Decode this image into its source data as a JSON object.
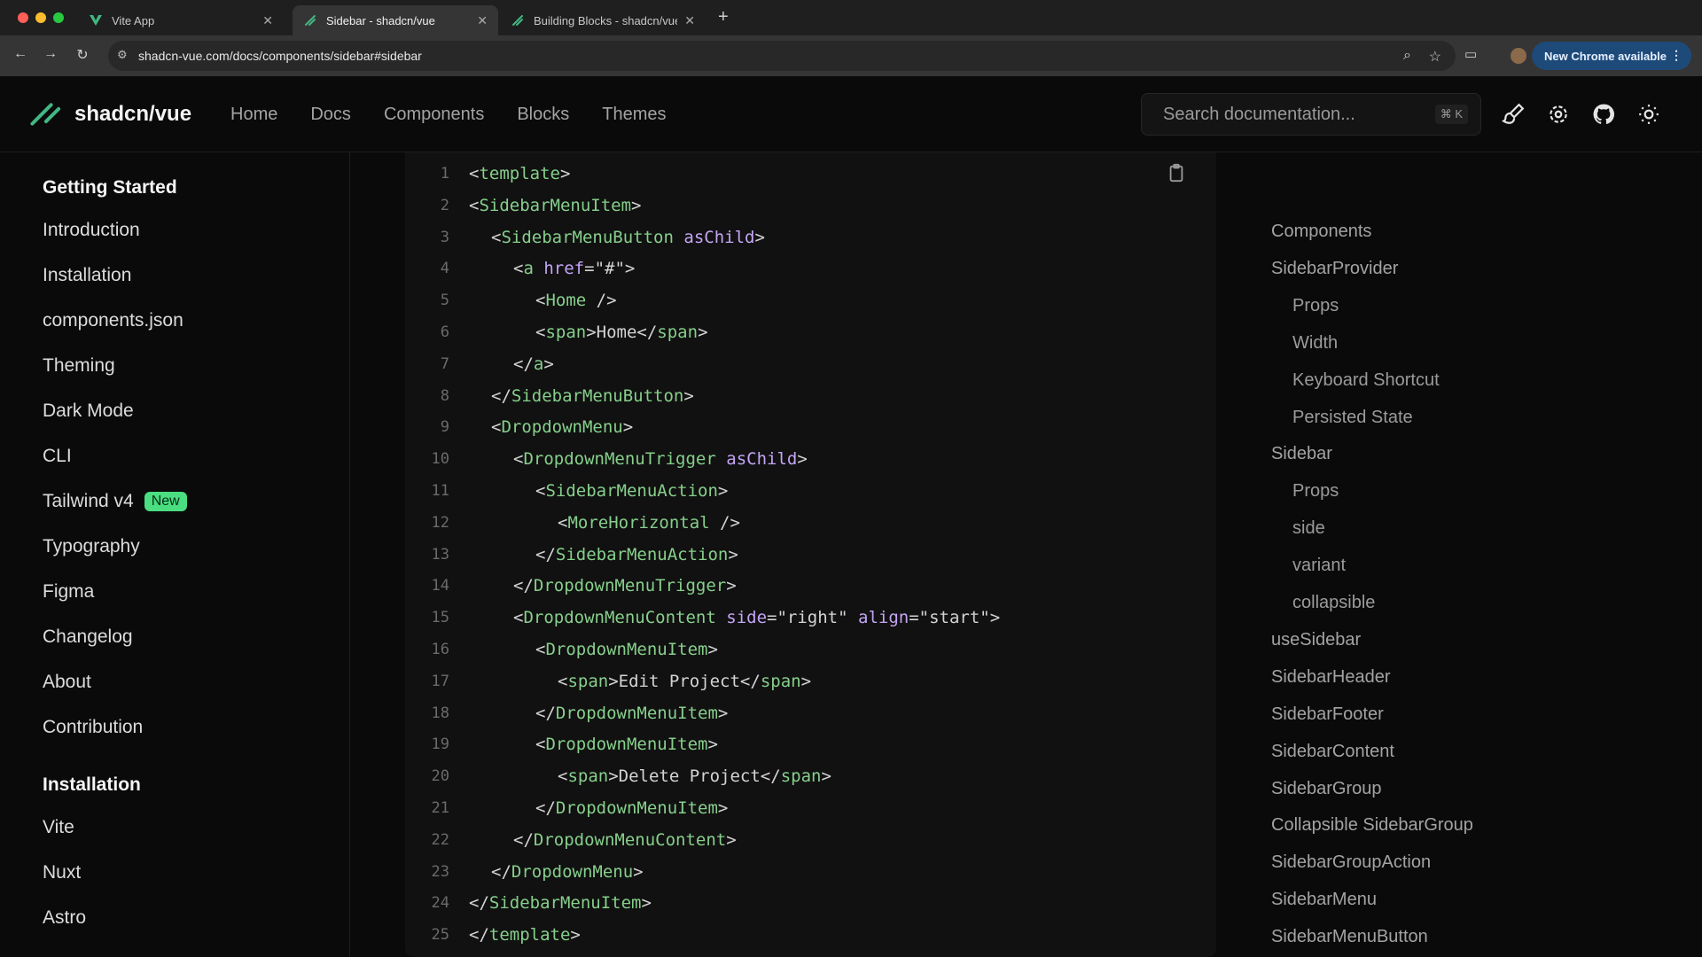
{
  "browser": {
    "tabs": [
      {
        "title": "Vite App",
        "active": false
      },
      {
        "title": "Sidebar - shadcn/vue",
        "active": true
      },
      {
        "title": "Building Blocks - shadcn/vue",
        "active": false
      }
    ],
    "url": "shadcn-vue.com/docs/components/sidebar#sidebar",
    "update_button": "New Chrome available"
  },
  "header": {
    "logo_text": "shadcn/vue",
    "nav": [
      "Home",
      "Docs",
      "Components",
      "Blocks",
      "Themes"
    ],
    "search_placeholder": "Search documentation...",
    "search_shortcut": "⌘ K"
  },
  "sidebar": {
    "sections": [
      {
        "title": "Getting Started",
        "items": [
          {
            "label": "Introduction"
          },
          {
            "label": "Installation"
          },
          {
            "label": "components.json"
          },
          {
            "label": "Theming"
          },
          {
            "label": "Dark Mode"
          },
          {
            "label": "CLI"
          },
          {
            "label": "Tailwind v4",
            "badge": "New"
          },
          {
            "label": "Typography"
          },
          {
            "label": "Figma"
          },
          {
            "label": "Changelog"
          },
          {
            "label": "About"
          },
          {
            "label": "Contribution"
          }
        ]
      },
      {
        "title": "Installation",
        "items": [
          {
            "label": "Vite"
          },
          {
            "label": "Nuxt"
          },
          {
            "label": "Astro"
          }
        ]
      }
    ]
  },
  "code": {
    "lines": [
      {
        "n": "1",
        "indent": 0,
        "tokens": [
          [
            "p",
            "<"
          ],
          [
            "tag",
            "template"
          ],
          [
            "p",
            ">"
          ]
        ]
      },
      {
        "n": "2",
        "indent": 0,
        "tokens": [
          [
            "p",
            "<"
          ],
          [
            "tag",
            "SidebarMenuItem"
          ],
          [
            "p",
            ">"
          ]
        ]
      },
      {
        "n": "3",
        "indent": 1,
        "tokens": [
          [
            "p",
            "<"
          ],
          [
            "tag",
            "SidebarMenuButton"
          ],
          [
            "p",
            " "
          ],
          [
            "attr",
            "asChild"
          ],
          [
            "p",
            ">"
          ]
        ]
      },
      {
        "n": "4",
        "indent": 2,
        "tokens": [
          [
            "p",
            "<"
          ],
          [
            "tag",
            "a"
          ],
          [
            "p",
            " "
          ],
          [
            "attr",
            "href"
          ],
          [
            "p",
            "="
          ],
          [
            "str",
            "\"#\""
          ],
          [
            "p",
            ">"
          ]
        ]
      },
      {
        "n": "5",
        "indent": 3,
        "tokens": [
          [
            "p",
            "<"
          ],
          [
            "tag",
            "Home"
          ],
          [
            "p",
            " />"
          ]
        ]
      },
      {
        "n": "6",
        "indent": 3,
        "tokens": [
          [
            "p",
            "<"
          ],
          [
            "tag",
            "span"
          ],
          [
            "p",
            ">Home</"
          ],
          [
            "tag",
            "span"
          ],
          [
            "p",
            ">"
          ]
        ]
      },
      {
        "n": "7",
        "indent": 2,
        "tokens": [
          [
            "p",
            "</"
          ],
          [
            "tag",
            "a"
          ],
          [
            "p",
            ">"
          ]
        ]
      },
      {
        "n": "8",
        "indent": 1,
        "tokens": [
          [
            "p",
            "</"
          ],
          [
            "tag",
            "SidebarMenuButton"
          ],
          [
            "p",
            ">"
          ]
        ]
      },
      {
        "n": "9",
        "indent": 1,
        "tokens": [
          [
            "p",
            "<"
          ],
          [
            "tag",
            "DropdownMenu"
          ],
          [
            "p",
            ">"
          ]
        ]
      },
      {
        "n": "10",
        "indent": 2,
        "tokens": [
          [
            "p",
            "<"
          ],
          [
            "tag",
            "DropdownMenuTrigger"
          ],
          [
            "p",
            " "
          ],
          [
            "attr",
            "asChild"
          ],
          [
            "p",
            ">"
          ]
        ]
      },
      {
        "n": "11",
        "indent": 3,
        "tokens": [
          [
            "p",
            "<"
          ],
          [
            "tag",
            "SidebarMenuAction"
          ],
          [
            "p",
            ">"
          ]
        ]
      },
      {
        "n": "12",
        "indent": 4,
        "tokens": [
          [
            "p",
            "<"
          ],
          [
            "tag",
            "MoreHorizontal"
          ],
          [
            "p",
            " />"
          ]
        ]
      },
      {
        "n": "13",
        "indent": 3,
        "tokens": [
          [
            "p",
            "</"
          ],
          [
            "tag",
            "SidebarMenuAction"
          ],
          [
            "p",
            ">"
          ]
        ]
      },
      {
        "n": "14",
        "indent": 2,
        "tokens": [
          [
            "p",
            "</"
          ],
          [
            "tag",
            "DropdownMenuTrigger"
          ],
          [
            "p",
            ">"
          ]
        ]
      },
      {
        "n": "15",
        "indent": 2,
        "tokens": [
          [
            "p",
            "<"
          ],
          [
            "tag",
            "DropdownMenuContent"
          ],
          [
            "p",
            " "
          ],
          [
            "attr",
            "side"
          ],
          [
            "p",
            "="
          ],
          [
            "str",
            "\"right\""
          ],
          [
            "p",
            " "
          ],
          [
            "attr",
            "align"
          ],
          [
            "p",
            "="
          ],
          [
            "str",
            "\"start\""
          ],
          [
            "p",
            ">"
          ]
        ]
      },
      {
        "n": "16",
        "indent": 3,
        "tokens": [
          [
            "p",
            "<"
          ],
          [
            "tag",
            "DropdownMenuItem"
          ],
          [
            "p",
            ">"
          ]
        ]
      },
      {
        "n": "17",
        "indent": 4,
        "tokens": [
          [
            "p",
            "<"
          ],
          [
            "tag",
            "span"
          ],
          [
            "p",
            ">Edit Project</"
          ],
          [
            "tag",
            "span"
          ],
          [
            "p",
            ">"
          ]
        ]
      },
      {
        "n": "18",
        "indent": 3,
        "tokens": [
          [
            "p",
            "</"
          ],
          [
            "tag",
            "DropdownMenuItem"
          ],
          [
            "p",
            ">"
          ]
        ]
      },
      {
        "n": "19",
        "indent": 3,
        "tokens": [
          [
            "p",
            "<"
          ],
          [
            "tag",
            "DropdownMenuItem"
          ],
          [
            "p",
            ">"
          ]
        ]
      },
      {
        "n": "20",
        "indent": 4,
        "tokens": [
          [
            "p",
            "<"
          ],
          [
            "tag",
            "span"
          ],
          [
            "p",
            ">Delete Project</"
          ],
          [
            "tag",
            "span"
          ],
          [
            "p",
            ">"
          ]
        ]
      },
      {
        "n": "21",
        "indent": 3,
        "tokens": [
          [
            "p",
            "</"
          ],
          [
            "tag",
            "DropdownMenuItem"
          ],
          [
            "p",
            ">"
          ]
        ]
      },
      {
        "n": "22",
        "indent": 2,
        "tokens": [
          [
            "p",
            "</"
          ],
          [
            "tag",
            "DropdownMenuContent"
          ],
          [
            "p",
            ">"
          ]
        ]
      },
      {
        "n": "23",
        "indent": 1,
        "tokens": [
          [
            "p",
            "</"
          ],
          [
            "tag",
            "DropdownMenu"
          ],
          [
            "p",
            ">"
          ]
        ]
      },
      {
        "n": "24",
        "indent": 0,
        "tokens": [
          [
            "p",
            "</"
          ],
          [
            "tag",
            "SidebarMenuItem"
          ],
          [
            "p",
            ">"
          ]
        ]
      },
      {
        "n": "25",
        "indent": 0,
        "tokens": [
          [
            "p",
            "</"
          ],
          [
            "tag",
            "template"
          ],
          [
            "p",
            ">"
          ]
        ]
      }
    ]
  },
  "toc": {
    "items": [
      {
        "label": "Components",
        "level": 0
      },
      {
        "label": "SidebarProvider",
        "level": 0
      },
      {
        "label": "Props",
        "level": 1
      },
      {
        "label": "Width",
        "level": 1
      },
      {
        "label": "Keyboard Shortcut",
        "level": 1
      },
      {
        "label": "Persisted State",
        "level": 1
      },
      {
        "label": "Sidebar",
        "level": 0
      },
      {
        "label": "Props",
        "level": 1
      },
      {
        "label": "side",
        "level": 1
      },
      {
        "label": "variant",
        "level": 1
      },
      {
        "label": "collapsible",
        "level": 1
      },
      {
        "label": "useSidebar",
        "level": 0
      },
      {
        "label": "SidebarHeader",
        "level": 0
      },
      {
        "label": "SidebarFooter",
        "level": 0
      },
      {
        "label": "SidebarContent",
        "level": 0
      },
      {
        "label": "SidebarGroup",
        "level": 0
      },
      {
        "label": "Collapsible SidebarGroup",
        "level": 0
      },
      {
        "label": "SidebarGroupAction",
        "level": 0
      },
      {
        "label": "SidebarMenu",
        "level": 0
      },
      {
        "label": "SidebarMenuButton",
        "level": 0
      }
    ]
  },
  "colors": {
    "accent": "#41b883",
    "badge": "#4ade80",
    "code_tag": "#86cf8b",
    "code_attr": "#c4a5f5"
  }
}
